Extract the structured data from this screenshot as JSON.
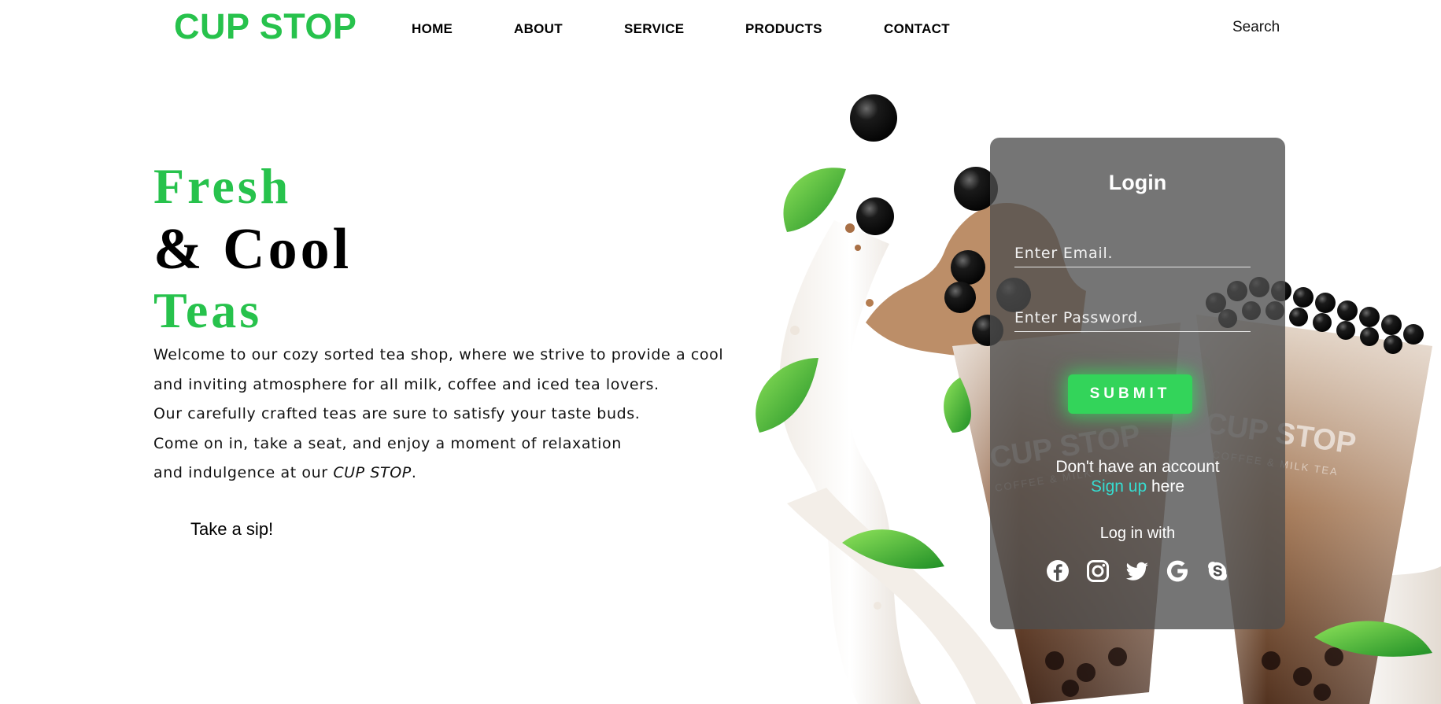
{
  "brand": {
    "name": "CUP STOP"
  },
  "nav": {
    "items": [
      "HOME",
      "ABOUT",
      "SERVICE",
      "PRODUCTS",
      "CONTACT"
    ],
    "search_label": "Search"
  },
  "hero": {
    "line1": "Fresh",
    "line2": "& Cool",
    "line3": "Teas",
    "description": {
      "line1": "Welcome to our cozy sorted tea shop, where we strive to provide a cool",
      "line2": "and inviting atmosphere for all milk, coffee and iced tea lovers.",
      "line3": "Our carefully crafted teas are sure to satisfy your taste buds.",
      "line4": "Come on in, take a seat, and enjoy a moment of relaxation",
      "line5_prefix": "and indulgence at our ",
      "line5_italic": "CUP STOP",
      "line5_suffix": "."
    },
    "cta": "Take a sip!"
  },
  "illustration": {
    "cup_logo_text": "CUP STOP",
    "cup_sub_text": "COFFEE & MILK TEA"
  },
  "login": {
    "title": "Login",
    "email_placeholder": "Enter Email.",
    "password_placeholder": "Enter Password.",
    "submit_label": "SUBMIT",
    "no_account_text": "Don't have an account",
    "signup_link": "Sign up",
    "signup_suffix": " here",
    "login_with": "Log in with",
    "social_icons": [
      "facebook-icon",
      "instagram-icon",
      "twitter-icon",
      "google-icon",
      "skype-icon"
    ]
  },
  "colors": {
    "brand_green": "#27c24c",
    "submit_green": "#33d45a",
    "signup_cyan": "#36dcd0",
    "card_bg": "#4e4e4e"
  }
}
